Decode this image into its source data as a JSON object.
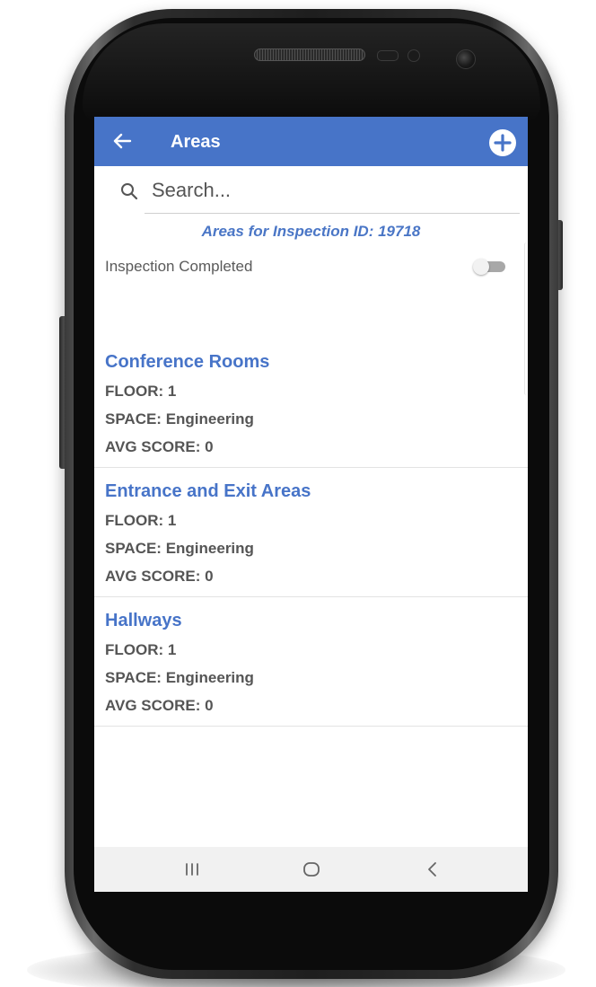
{
  "header": {
    "title": "Areas",
    "back_icon": "arrow-left-icon",
    "add_icon": "plus-circle-icon",
    "color": "#4774c8"
  },
  "search": {
    "placeholder": "Search...",
    "value": ""
  },
  "inspection": {
    "heading": "Areas for Inspection ID: 19718",
    "completed_label": "Inspection Completed",
    "completed": false
  },
  "areas": [
    {
      "name": "Conference Rooms",
      "floor": "FLOOR: 1",
      "space": "SPACE: Engineering",
      "avg_score": "AVG SCORE: 0"
    },
    {
      "name": "Entrance and Exit Areas",
      "floor": "FLOOR: 1",
      "space": "SPACE: Engineering",
      "avg_score": "AVG SCORE: 0"
    },
    {
      "name": "Hallways",
      "floor": "FLOOR: 1",
      "space": "SPACE: Engineering",
      "avg_score": "AVG SCORE: 0"
    }
  ],
  "system_nav": {
    "recents_icon": "recents-icon",
    "home_icon": "home-icon",
    "back_icon": "back-chevron-icon"
  }
}
